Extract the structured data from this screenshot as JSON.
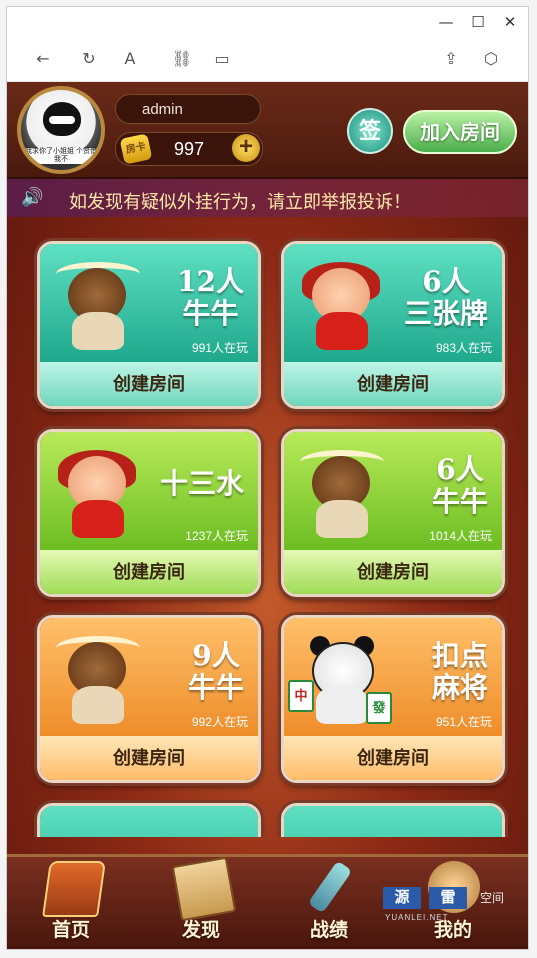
{
  "browser": {
    "window_buttons": {
      "minimize": "—",
      "maximize": "☐",
      "close": "✕"
    },
    "toolbar": {
      "back": "←",
      "refresh": "↻",
      "text": "A",
      "link": "⛓",
      "tabs": "▭",
      "share": "⇪",
      "extension": "⬡"
    }
  },
  "header": {
    "avatar_caption": "我求你了小姐姐 个赞借我不",
    "username": "admin",
    "coins": "997",
    "coin_icon_text": "房卡",
    "plus": "+",
    "sign_label": "签",
    "join_label": "加入房间"
  },
  "notice": {
    "text": "如发现有疑似外挂行为，请立即举报投诉！"
  },
  "games": [
    {
      "line1": "12人",
      "line2": "牛牛",
      "players": "991人在玩",
      "action": "创建房间",
      "theme": "teal",
      "char": "bull"
    },
    {
      "line1": "6人",
      "line2": "三张牌",
      "players": "983人在玩",
      "action": "创建房间",
      "theme": "teal",
      "char": "girl"
    },
    {
      "line1": "十三水",
      "line2": "",
      "players": "1237人在玩",
      "action": "创建房间",
      "theme": "green",
      "char": "girl"
    },
    {
      "line1": "6人",
      "line2": "牛牛",
      "players": "1014人在玩",
      "action": "创建房间",
      "theme": "green",
      "char": "bull"
    },
    {
      "line1": "9人",
      "line2": "牛牛",
      "players": "992人在玩",
      "action": "创建房间",
      "theme": "orange",
      "char": "bull"
    },
    {
      "line1": "扣点",
      "line2": "麻将",
      "players": "951人在玩",
      "action": "创建房间",
      "theme": "orange",
      "char": "panda"
    },
    {
      "line1": "",
      "line2": "",
      "players": "",
      "action": "",
      "theme": "teal",
      "char": "none"
    },
    {
      "line1": "",
      "line2": "",
      "players": "",
      "action": "",
      "theme": "teal",
      "char": "none"
    }
  ],
  "tiles": {
    "red": "中",
    "green": "發"
  },
  "nav": {
    "home": "首页",
    "discover": "发现",
    "records": "战绩",
    "mine": "我的"
  },
  "watermark": {
    "a": "源",
    "b": "雷",
    "c": "空间",
    "sub": "YUANLEI.NET"
  },
  "colors": {
    "teal": "#2fc0a0",
    "green": "#86cc2a",
    "orange": "#f2a040",
    "notice_text": "#ffe9a8"
  }
}
